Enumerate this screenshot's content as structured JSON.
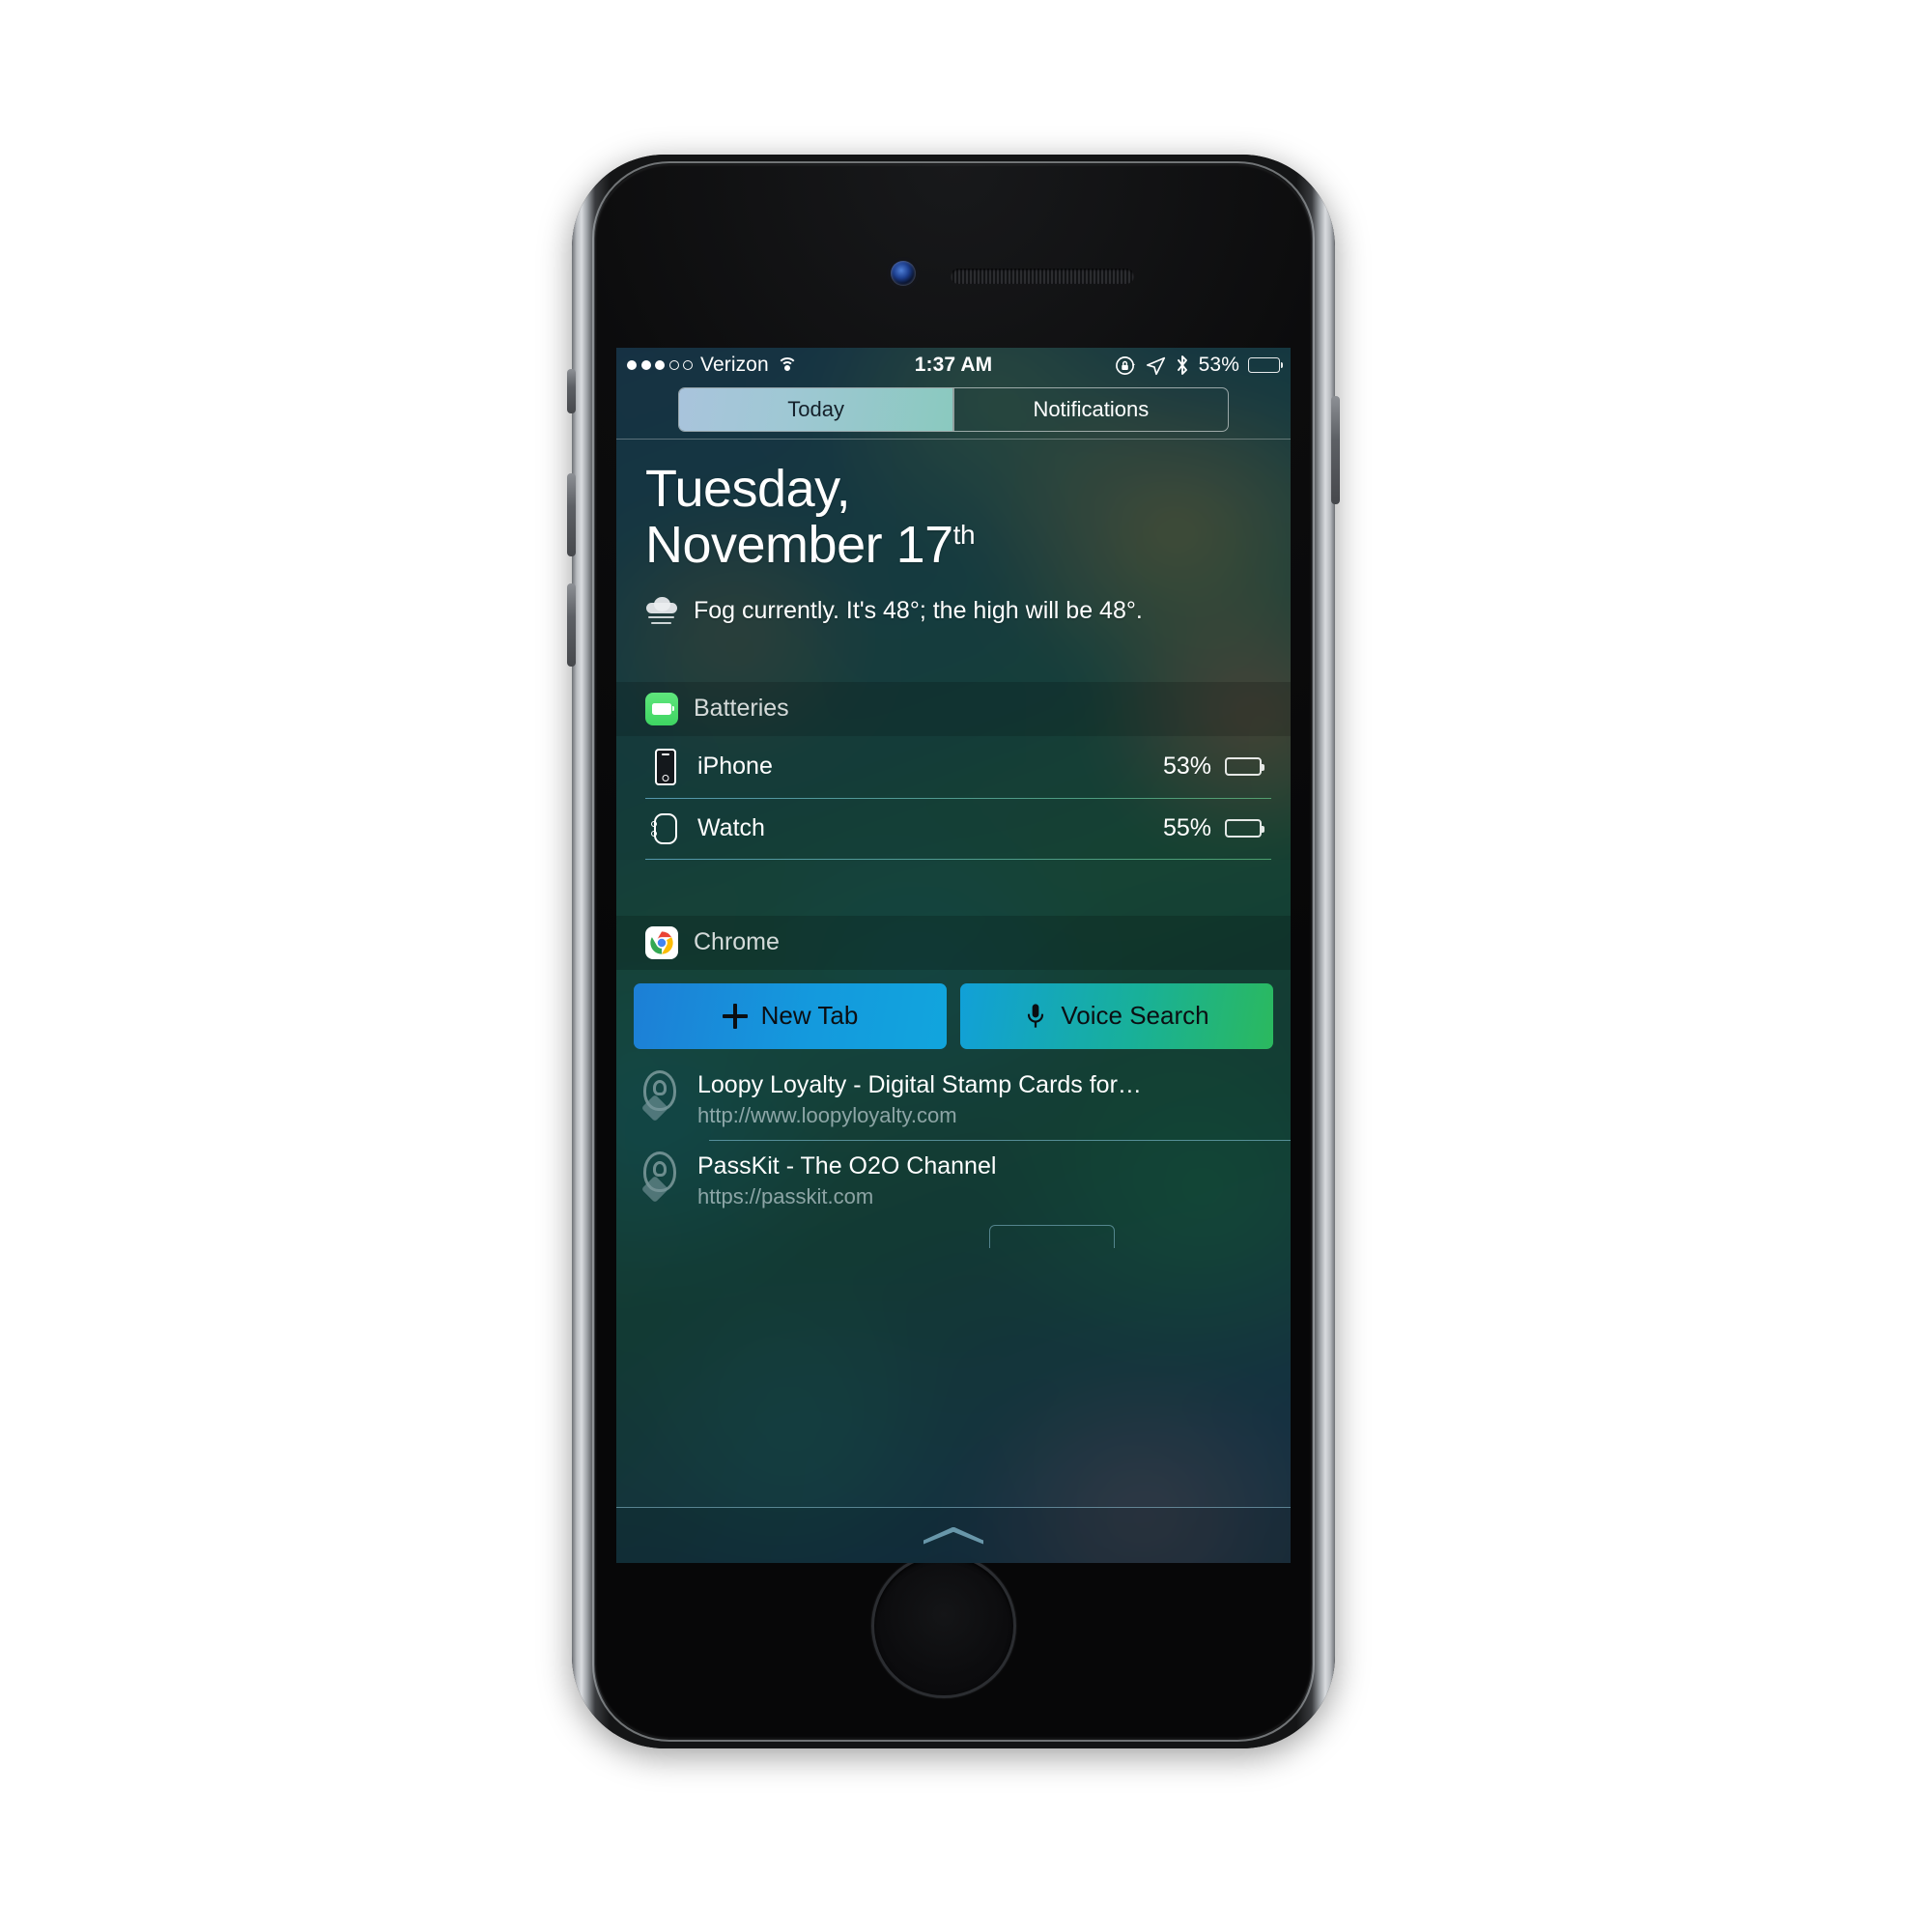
{
  "status_bar": {
    "signal_dots_filled": 3,
    "signal_dots_total": 5,
    "carrier": "Verizon",
    "wifi_icon": "wifi-icon",
    "time": "1:37 AM",
    "rotation_lock_icon": "rotation-lock-icon",
    "location_icon": "location-arrow-icon",
    "bluetooth_icon": "bluetooth-icon",
    "battery_percent_label": "53%",
    "battery_level": 53
  },
  "segmented_control": {
    "tabs": [
      {
        "label": "Today",
        "selected": true
      },
      {
        "label": "Notifications",
        "selected": false
      }
    ]
  },
  "today": {
    "date_line1": "Tuesday,",
    "date_line2_main": "November 17",
    "date_line2_sup": "th",
    "weather_icon": "fog-icon",
    "weather_text": "Fog currently. It's 48°; the high will be 48°."
  },
  "batteries_widget": {
    "icon": "batteries-app-icon",
    "title": "Batteries",
    "devices": [
      {
        "icon": "iphone-icon",
        "name": "iPhone",
        "percent_label": "53%",
        "level": 53
      },
      {
        "icon": "watch-icon",
        "name": "Watch",
        "percent_label": "55%",
        "level": 55
      }
    ]
  },
  "chrome_widget": {
    "icon": "chrome-app-icon",
    "title": "Chrome",
    "actions": [
      {
        "icon": "plus-icon",
        "label": "New Tab"
      },
      {
        "icon": "microphone-icon",
        "label": "Voice Search"
      }
    ],
    "suggestions": [
      {
        "icon": "physical-web-pin-icon",
        "title": "Loopy Loyalty - Digital Stamp Cards for…",
        "url": "http://www.loopyloyalty.com"
      },
      {
        "icon": "physical-web-pin-icon",
        "title": "PassKit - The O2O Channel",
        "url": "https://passkit.com"
      }
    ]
  },
  "grabber": {
    "icon": "chevron-up-grabber-icon"
  },
  "colors": {
    "accent_green": "#3ddc64",
    "newtab_blue": "#1499dd",
    "voice_teal": "#18b09a"
  }
}
